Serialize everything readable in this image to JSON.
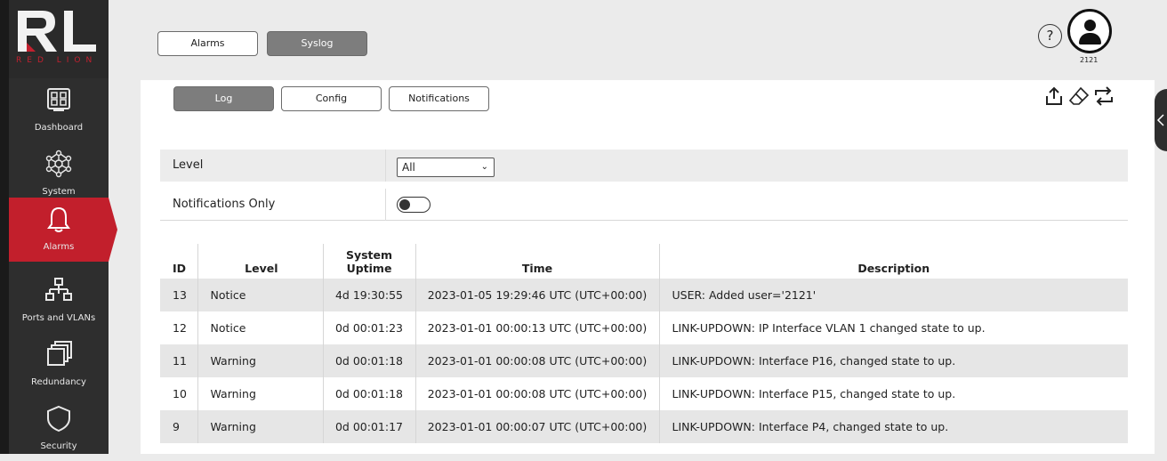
{
  "logo": {
    "brand_text": "RED LION"
  },
  "sidebar": {
    "items": [
      {
        "label": "Dashboard",
        "icon": "dashboard-icon"
      },
      {
        "label": "System",
        "icon": "system-network-icon"
      },
      {
        "label": "Alarms",
        "icon": "bell-icon",
        "active": true
      },
      {
        "label": "Ports and VLANs",
        "icon": "ports-vlan-icon"
      },
      {
        "label": "Redundancy",
        "icon": "redundancy-icon"
      },
      {
        "label": "Security",
        "icon": "shield-icon"
      }
    ]
  },
  "top_tabs": [
    {
      "label": "Alarms",
      "active": false
    },
    {
      "label": "Syslog",
      "active": true
    }
  ],
  "header": {
    "help_symbol": "?",
    "username": "2121"
  },
  "sub_tabs": [
    {
      "label": "Log",
      "active": true
    },
    {
      "label": "Config",
      "active": false
    },
    {
      "label": "Notifications",
      "active": false
    }
  ],
  "toolbar": [
    "export-icon",
    "eraser-icon",
    "refresh-icon"
  ],
  "filters": {
    "level_label": "Level",
    "level_value": "All",
    "notifications_label": "Notifications Only",
    "notifications_on": false
  },
  "table": {
    "columns": [
      "ID",
      "Level",
      "System Uptime",
      "Time",
      "Description"
    ],
    "column_uptime_line1": "System",
    "column_uptime_line2": "Uptime",
    "rows": [
      {
        "id": "13",
        "level": "Notice",
        "uptime": "4d 19:30:55",
        "time": "2023-01-05 19:29:46 UTC (UTC+00:00)",
        "description": "USER: Added user='2121'"
      },
      {
        "id": "12",
        "level": "Notice",
        "uptime": "0d 00:01:23",
        "time": "2023-01-01 00:00:13 UTC (UTC+00:00)",
        "description": "LINK-UPDOWN: IP Interface VLAN 1 changed state to up."
      },
      {
        "id": "11",
        "level": "Warning",
        "uptime": "0d 00:01:18",
        "time": "2023-01-01 00:00:08 UTC (UTC+00:00)",
        "description": "LINK-UPDOWN: Interface P16, changed state to up."
      },
      {
        "id": "10",
        "level": "Warning",
        "uptime": "0d 00:01:18",
        "time": "2023-01-01 00:00:08 UTC (UTC+00:00)",
        "description": "LINK-UPDOWN: Interface P15, changed state to up."
      },
      {
        "id": "9",
        "level": "Warning",
        "uptime": "0d 00:01:17",
        "time": "2023-01-01 00:00:07 UTC (UTC+00:00)",
        "description": "LINK-UPDOWN: Interface P4, changed state to up."
      }
    ]
  },
  "colors": {
    "accent": "#c21f2c",
    "sidebar": "#2e2e2e",
    "active_tab": "#7d7d7d"
  }
}
